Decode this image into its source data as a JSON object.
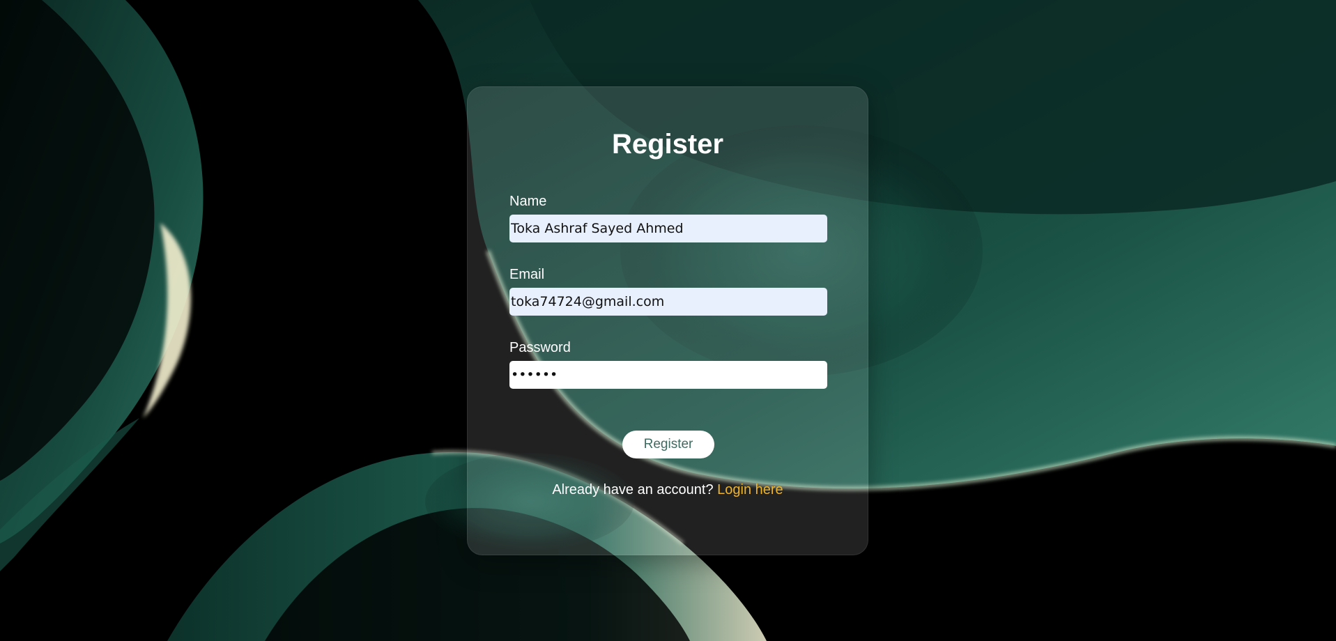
{
  "background": {
    "base_color": "#000000",
    "accent_color": "#1f6b5a",
    "highlight_color": "#f4f1d6"
  },
  "form": {
    "title": "Register",
    "fields": [
      {
        "label": "Name",
        "value": "Toka Ashraf Sayed Ahmed",
        "type": "text"
      },
      {
        "label": "Email",
        "value": "toka74724@gmail.com",
        "type": "email"
      },
      {
        "label": "Password",
        "value": "••••••",
        "type": "password"
      }
    ],
    "submit_label": "Register",
    "login_prompt": "Already have an account?",
    "login_link_label": "Login here"
  },
  "colors": {
    "link": "#f0b429",
    "button_text": "#3f6b60",
    "autofill_bg": "#e8f0fe"
  }
}
